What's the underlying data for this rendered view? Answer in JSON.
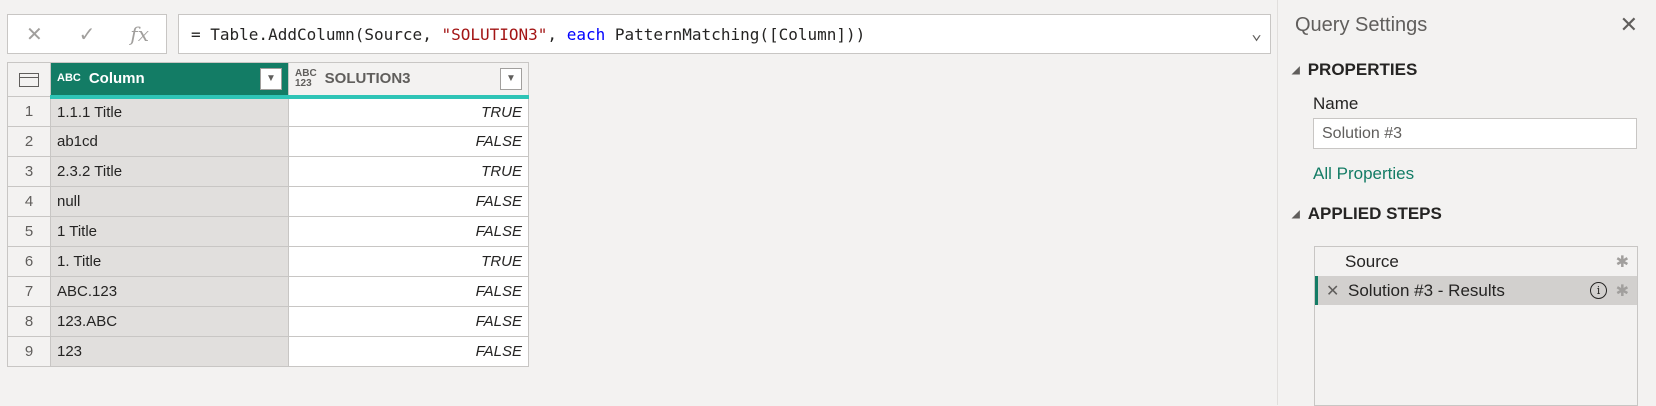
{
  "formula_bar": {
    "cancel_glyph": "✕",
    "commit_glyph": "✓",
    "fx_label": "fx",
    "formula_prefix": "= Table.AddColumn(Source, ",
    "formula_string": "\"SOLUTION3\"",
    "formula_mid": ", ",
    "formula_keyword": "each",
    "formula_suffix": " PatternMatching([Column]))",
    "expand_glyph": "⌄"
  },
  "grid": {
    "columns": [
      {
        "name": "Column",
        "type_icon": "ABC"
      },
      {
        "name": "SOLUTION3",
        "type_icon_top": "ABC",
        "type_icon_bottom": "123"
      }
    ],
    "rows": [
      {
        "num": "1",
        "col1": "1.1.1 Title",
        "col2": "TRUE"
      },
      {
        "num": "2",
        "col1": "ab1cd",
        "col2": "FALSE"
      },
      {
        "num": "3",
        "col1": "2.3.2 Title",
        "col2": "TRUE"
      },
      {
        "num": "4",
        "col1": "null",
        "col2": "FALSE"
      },
      {
        "num": "5",
        "col1": "1 Title",
        "col2": "FALSE"
      },
      {
        "num": "6",
        "col1": "1. Title",
        "col2": "TRUE"
      },
      {
        "num": "7",
        "col1": "ABC.123",
        "col2": "FALSE"
      },
      {
        "num": "8",
        "col1": "123.ABC",
        "col2": "FALSE"
      },
      {
        "num": "9",
        "col1": "123",
        "col2": "FALSE"
      }
    ]
  },
  "query_settings": {
    "title": "Query Settings",
    "properties_heading": "PROPERTIES",
    "name_label": "Name",
    "name_value": "Solution #3",
    "all_properties_link": "All Properties",
    "applied_steps_heading": "APPLIED STEPS",
    "steps": [
      {
        "label": "Source"
      },
      {
        "label": "Solution #3 - Results"
      }
    ]
  },
  "colors": {
    "accent": "#137c65",
    "header_underline": "#2ec4b6",
    "string": "#a31515",
    "keyword": "#0000ff"
  }
}
